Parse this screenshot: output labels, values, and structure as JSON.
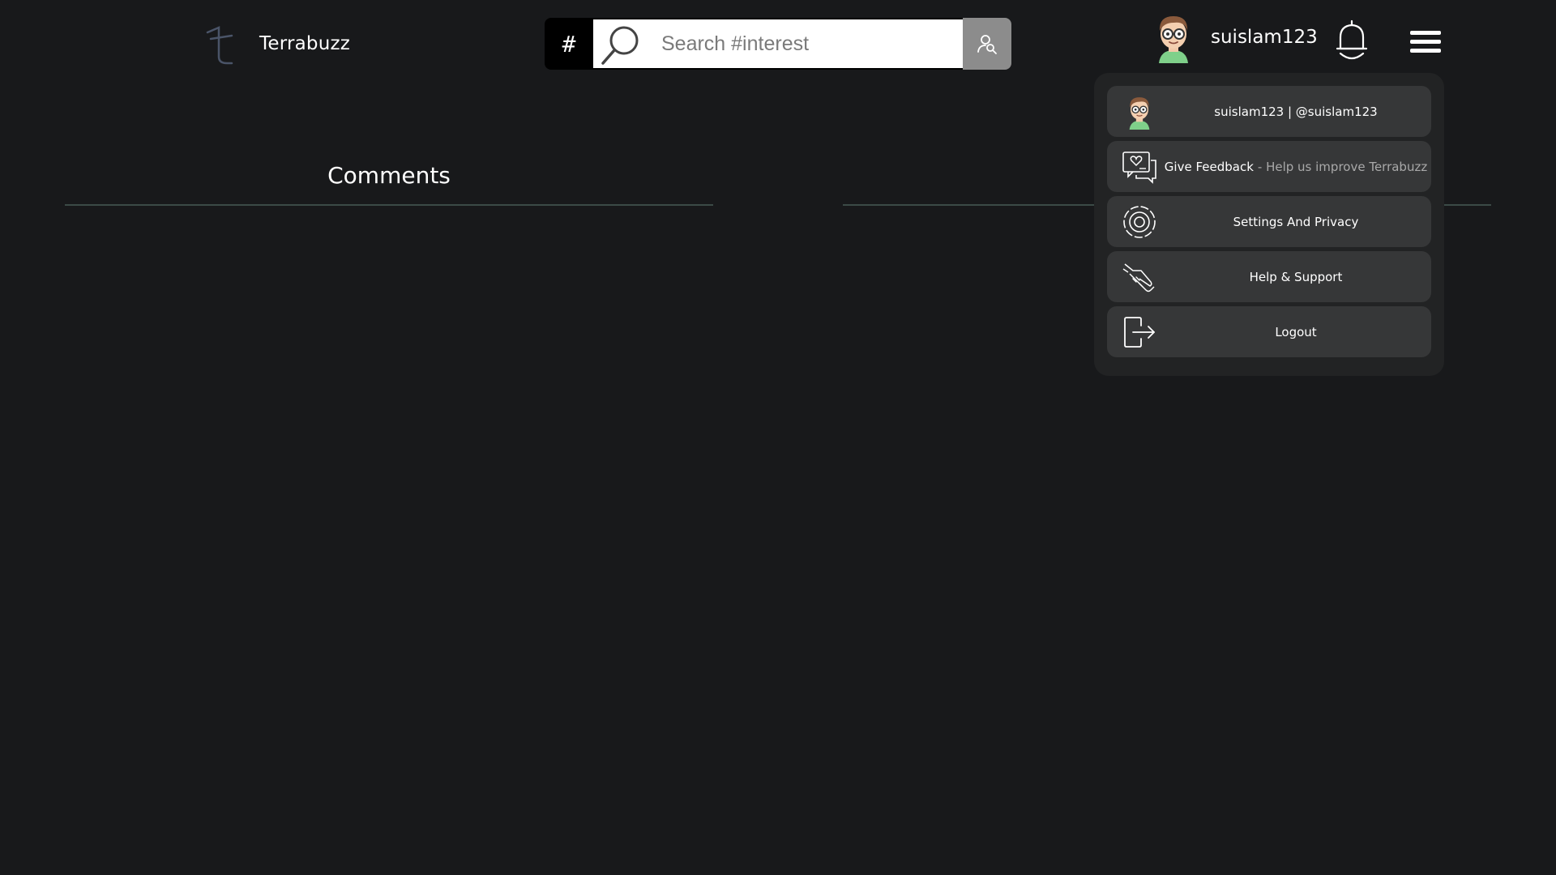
{
  "header": {
    "brand_name": "Terrabuzz",
    "search": {
      "hash_symbol": "#",
      "placeholder": "Search #interest"
    },
    "user": {
      "username": "suislam123"
    }
  },
  "main": {
    "comments_title": "Comments"
  },
  "menu": {
    "profile": {
      "label": "suislam123 | @suislam123"
    },
    "feedback": {
      "label": "Give Feedback",
      "sublabel": "- Help us improve Terrabuzz"
    },
    "settings": {
      "label": "Settings And Privacy"
    },
    "help": {
      "label": "Help & Support"
    },
    "logout": {
      "label": "Logout"
    }
  },
  "colors": {
    "background": "#18191b",
    "menu_background": "#222324",
    "menu_item": "#363738",
    "divider": "#3b4a46",
    "logo_stroke": "#4a5468"
  },
  "icons": {
    "brand": "terrabuzz-logo-icon",
    "search": "search-icon",
    "people_search": "user-search-icon",
    "notifications": "bell-icon",
    "menu": "hamburger-menu-icon",
    "feedback": "feedback-chat-icon",
    "settings": "gear-icon",
    "help": "handshake-icon",
    "logout": "logout-icon"
  }
}
